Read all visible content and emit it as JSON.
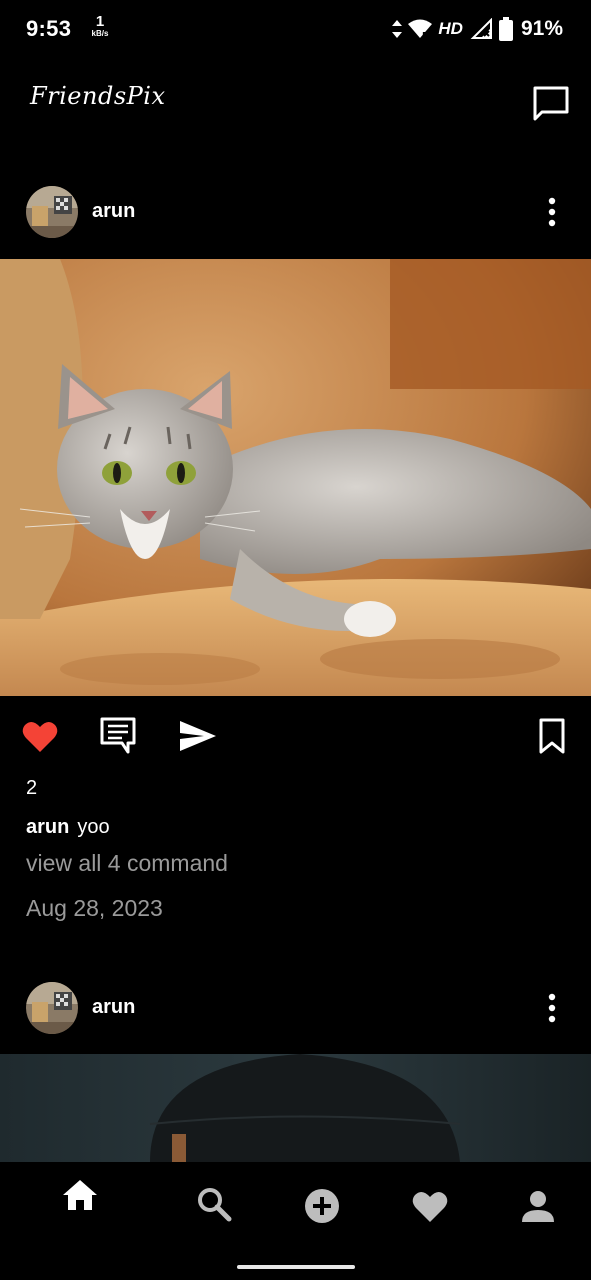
{
  "status_bar": {
    "time": "9:53",
    "net_speed_value": "1",
    "net_speed_unit": "kB/s",
    "network_label": "HD",
    "battery_percent": "91%"
  },
  "app": {
    "logo": "FriendsPix",
    "messages_icon": "chat-bubble-icon"
  },
  "posts": [
    {
      "username": "arun",
      "image_desc_icon": "cat-photo",
      "likes": "2",
      "caption_user": "arun",
      "caption_text": "yoo",
      "view_all": "view all 4 command",
      "date": "Aug 28, 2023"
    },
    {
      "username": "arun"
    }
  ],
  "actions": {
    "like_color": "#f44336",
    "like_icon": "heart-filled-icon",
    "comment_icon": "comment-icon",
    "share_icon": "send-icon",
    "save_icon": "bookmark-icon"
  },
  "bottom_nav": [
    "home-icon",
    "search-icon",
    "add-circle-icon",
    "heart-icon",
    "profile-icon"
  ]
}
